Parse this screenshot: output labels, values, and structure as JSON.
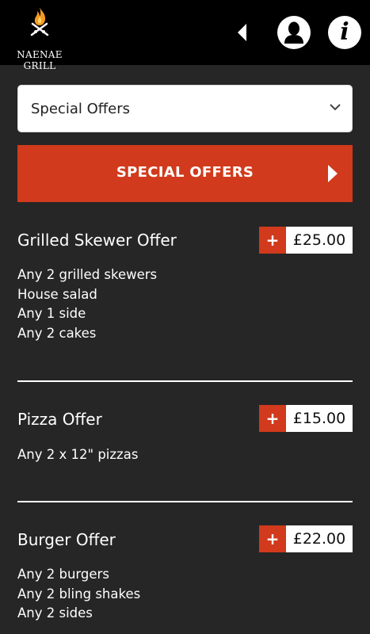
{
  "brand": {
    "name": "NAENAE GRILL",
    "logo_icon": "flame-skewers-icon"
  },
  "header": {
    "back_icon": "back-arrow-icon",
    "account_icon": "user-icon",
    "info_icon": "info-icon",
    "info_glyph": "i"
  },
  "category_select": {
    "selected": "Special Offers",
    "chevron_icon": "chevron-down-icon"
  },
  "banner": {
    "title": "SPECIAL OFFERS",
    "arrow_icon": "play-arrow-icon"
  },
  "offers": [
    {
      "name": "Grilled Skewer Offer",
      "add_label": "+",
      "price": "£25.00",
      "lines": [
        "Any 2 grilled skewers",
        "House salad",
        "Any 1 side",
        "Any 2 cakes"
      ]
    },
    {
      "name": "Pizza Offer",
      "add_label": "+",
      "price": "£15.00",
      "lines": [
        "Any 2 x 12\" pizzas"
      ]
    },
    {
      "name": "Burger Offer",
      "add_label": "+",
      "price": "£22.00",
      "lines": [
        "Any 2 burgers",
        "Any 2 bling shakes",
        "Any 2 sides"
      ]
    }
  ],
  "colors": {
    "accent": "#d13a1c",
    "background": "#262626",
    "topbar": "#000000",
    "flame": "#f29a1f"
  }
}
